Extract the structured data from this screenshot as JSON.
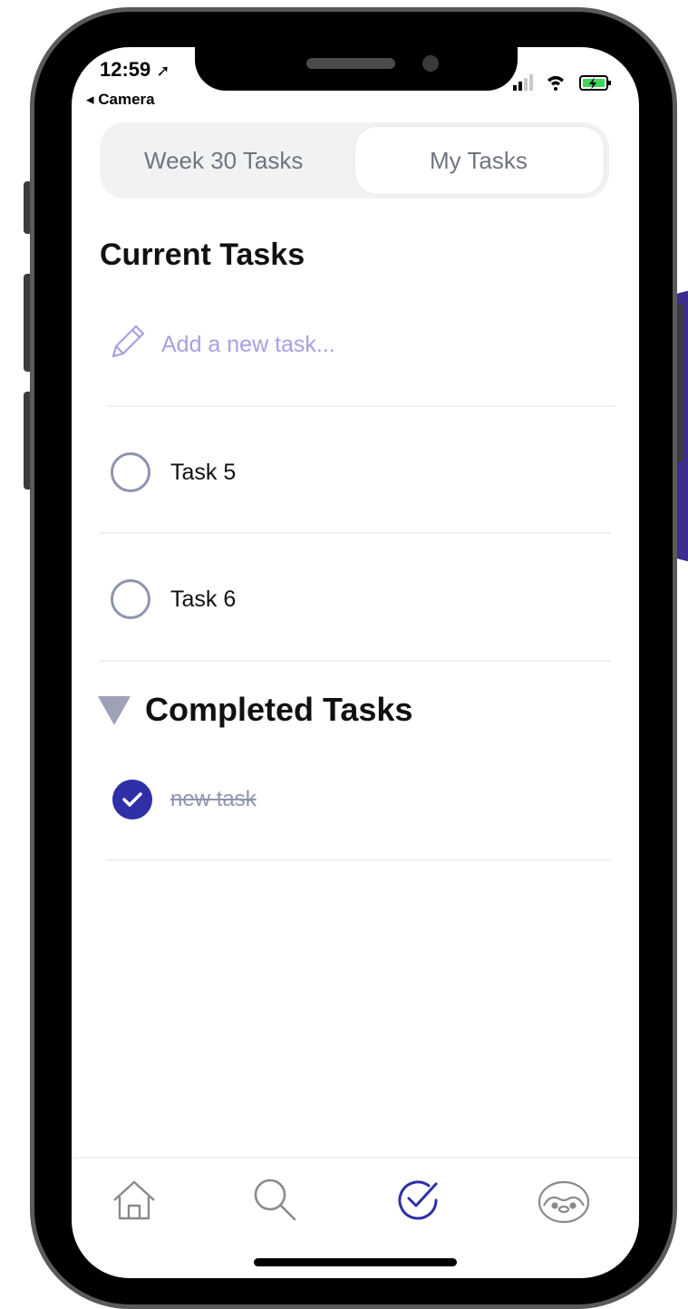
{
  "status_bar": {
    "time": "12:59",
    "back_label": "◂ Camera"
  },
  "segmented": {
    "tab_week": "Week 30 Tasks",
    "tab_my": "My Tasks",
    "active": "My Tasks"
  },
  "current": {
    "title": "Current Tasks",
    "add_placeholder": "Add a new task...",
    "tasks": [
      "Task 5",
      "Task 6"
    ]
  },
  "completed": {
    "title": "Completed Tasks",
    "tasks": [
      "new task"
    ]
  },
  "tabbar": {
    "items": [
      "home-icon",
      "search-icon",
      "tasks-check-icon",
      "penguin-profile-icon"
    ],
    "active": "tasks-check-icon"
  },
  "colors": {
    "accent": "#2f2fa8",
    "placeholder": "#a8a0e6",
    "muted": "#8e94ad"
  }
}
